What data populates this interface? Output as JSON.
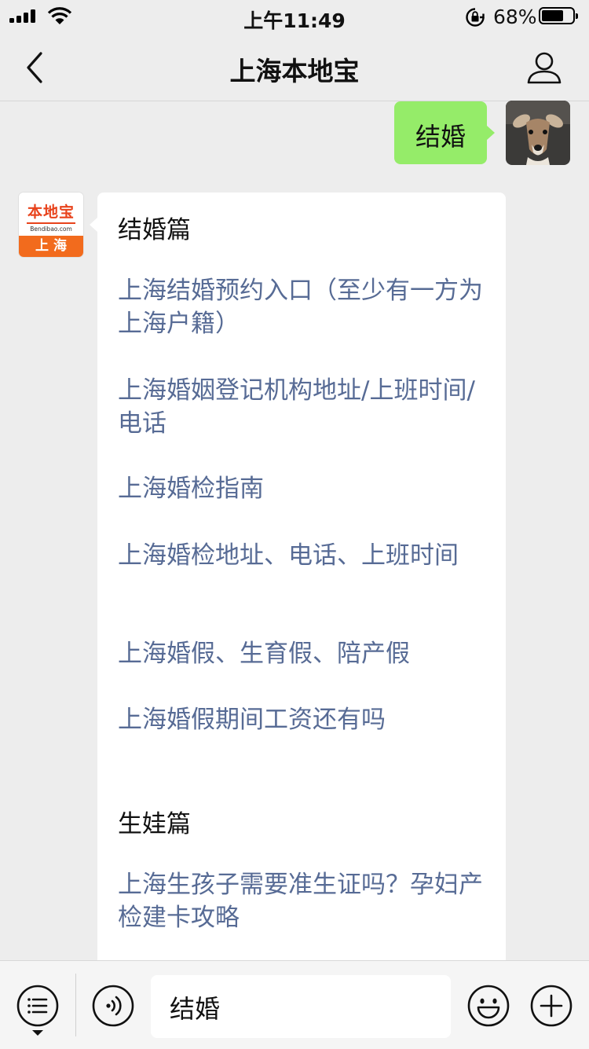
{
  "status_bar": {
    "time": "上午11:49",
    "battery_percent": "68%",
    "battery_level": 0.68
  },
  "nav": {
    "title": "上海本地宝"
  },
  "my_message": {
    "text": "结婚"
  },
  "bot_message": {
    "avatar": {
      "brand": "本地宝",
      "site": "Bendibao.com",
      "city": "上 海",
      "brand_color": "#f26b1d"
    },
    "sections": [
      {
        "heading": "结婚篇",
        "links": [
          "上海结婚预约入口（至少有一方为上海户籍）",
          "上海婚姻登记机构地址/上班时间/电话",
          "上海婚检指南",
          "上海婚检地址、电话、上班时间",
          "上海婚假、生育假、陪产假",
          "上海婚假期间工资还有吗"
        ]
      },
      {
        "heading": "生娃篇",
        "links": [
          "上海生孩子需要准生证吗？孕妇产检建卡攻略"
        ]
      }
    ]
  },
  "input_bar": {
    "value": "结婚"
  },
  "colors": {
    "my_bubble": "#95ec69",
    "link": "#576b95",
    "background": "#ededed"
  },
  "icons": [
    "signal-icon",
    "wifi-icon",
    "rotation-lock-icon",
    "battery-icon",
    "back-icon",
    "profile-icon",
    "menu-list-icon",
    "voice-icon",
    "emoji-icon",
    "plus-icon"
  ]
}
